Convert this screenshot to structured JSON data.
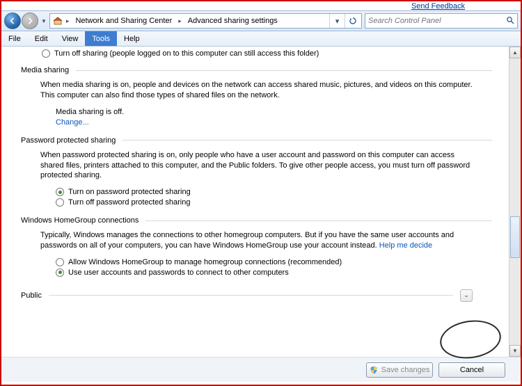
{
  "top_hint": "Send Feedback",
  "breadcrumb": {
    "item1": "Network and Sharing Center",
    "item2": "Advanced sharing settings"
  },
  "search": {
    "placeholder": "Search Control Panel"
  },
  "menu": {
    "file": "File",
    "edit": "Edit",
    "view": "View",
    "tools": "Tools",
    "help": "Help"
  },
  "partial_option": "Turn off sharing (people logged on to this computer can still access this folder)",
  "media": {
    "title": "Media sharing",
    "desc": "When media sharing is on, people and devices on the network can access shared music, pictures, and videos on this computer. This computer can also find those types of shared files on the network.",
    "status": "Media sharing is off.",
    "change": "Change..."
  },
  "password": {
    "title": "Password protected sharing",
    "desc": "When password protected sharing is on, only people who have a user account and password on this computer can access shared files, printers attached to this computer, and the Public folders. To give other people access, you must turn off password protected sharing.",
    "opt_on": "Turn on password protected sharing",
    "opt_off": "Turn off password protected sharing",
    "selected": "on"
  },
  "homegroup": {
    "title": "Windows HomeGroup connections",
    "desc": "Typically, Windows manages the connections to other homegroup computers.  But if you have the same user accounts and passwords on all of your computers, you can have Windows HomeGroup use your account instead.  ",
    "help_link": "Help me decide",
    "opt_allow": "Allow Windows HomeGroup to manage homegroup connections (recommended)",
    "opt_user": "Use user accounts and passwords to connect to other computers",
    "selected": "user"
  },
  "public": {
    "title": "Public"
  },
  "buttons": {
    "save": "Save changes",
    "cancel": "Cancel"
  }
}
